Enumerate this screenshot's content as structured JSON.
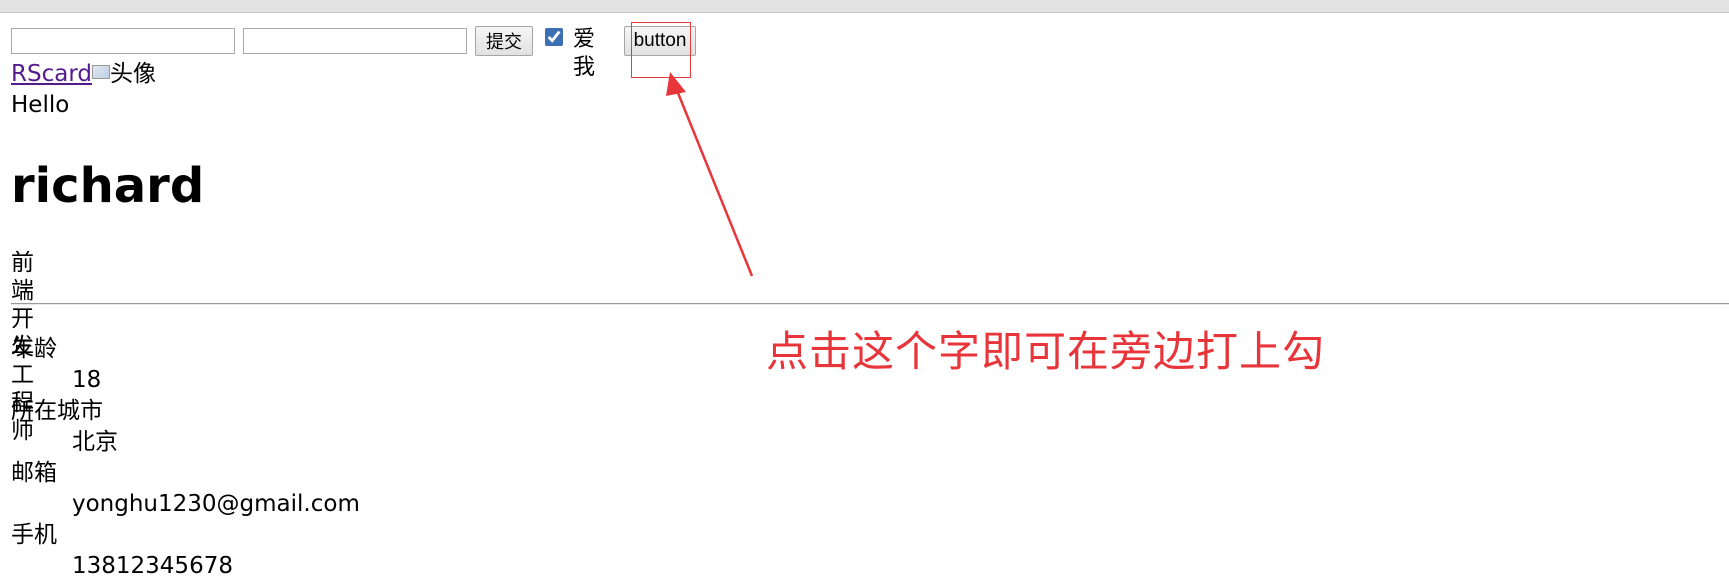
{
  "form": {
    "input1_value": "",
    "input2_value": "",
    "submit_label": "提交",
    "checkbox_checked": true,
    "checkbox_label": "爱我",
    "button_label": "button"
  },
  "profile": {
    "link_text": "RScard",
    "avatar_alt": "头像",
    "greeting": "Hello",
    "name": "richard",
    "title": "前端开发工程师"
  },
  "info": [
    {
      "label": "年龄",
      "value": "18"
    },
    {
      "label": "所在城市",
      "value": "北京"
    },
    {
      "label": "邮箱",
      "value": "yonghu1230@gmail.com"
    },
    {
      "label": "手机",
      "value": "13812345678"
    }
  ],
  "annotation": {
    "text": "点击这个字即可在旁边打上勾",
    "color": "#e8353a"
  },
  "colors": {
    "link": "#551a8b",
    "annotation": "#e8353a",
    "topbar": "#e3e3e3"
  }
}
